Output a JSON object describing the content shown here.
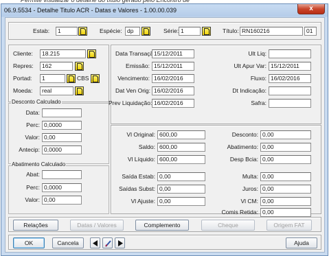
{
  "page_caption": "Permite visualizar o detalhe do título gerado pelo Encontro de",
  "window": {
    "title": "06.9.5534 - Detalhe Titulo ACR - Datas e Valores - 1.00.00.039",
    "close_symbol": "x"
  },
  "header": {
    "estab_label": "Estab:",
    "estab_value": "1",
    "especie_label": "Espécie:",
    "especie_value": "dp",
    "serie_label": "Série:",
    "serie_value": "1",
    "titulo_label": "Título:",
    "titulo_value": "RN160216",
    "parcela_value": "01"
  },
  "client": {
    "cliente_label": "Cliente:",
    "cliente_value": "18.215",
    "repres_label": "Repres:",
    "repres_value": "162",
    "portad_label": "Portad:",
    "portad_value": "1",
    "carteira_value": "CBS",
    "moeda_label": "Moeda:",
    "moeda_value": "real"
  },
  "dates": {
    "data_transacao_label": "Data Transação:",
    "data_transacao": "15/12/2011",
    "emissao_label": "Emissão:",
    "emissao": "15/12/2011",
    "vencimento_label": "Vencimento:",
    "vencimento": "16/02/2016",
    "dat_ven_orig_label": "Dat Ven Orig:",
    "dat_ven_orig": "16/02/2016",
    "prev_liquidacao_label": "Prev Liquidação:",
    "prev_liquidacao": "16/02/2016",
    "ult_liq_label": "Ult Liq:",
    "ult_liq": "",
    "ult_apur_var_label": "Ult Apur Var:",
    "ult_apur_var": "15/12/2011",
    "fluxo_label": "Fluxo:",
    "fluxo": "16/02/2016",
    "dt_indicacao_label": "Dt Indicação:",
    "dt_indicacao": "",
    "safra_label": "Safra:",
    "safra": ""
  },
  "desconto": {
    "title": "Desconto Calculado",
    "data_label": "Data:",
    "data_value": "",
    "perc_label": "Perc:",
    "perc_value": "0,0000",
    "valor_label": "Valor:",
    "valor_value": "0,00",
    "antecip_label": "Antecip:",
    "antecip_value": "0,0000"
  },
  "abatimento": {
    "title": "Abatimento Calculado",
    "abat_label": "Abat:",
    "abat_value": "",
    "perc_label": "Perc:",
    "perc_value": "0,0000",
    "valor_label": "Valor:",
    "valor_value": "0,00"
  },
  "values": {
    "vl_original_label": "Vl Original:",
    "vl_original": "600,00",
    "saldo_label": "Saldo:",
    "saldo": "600,00",
    "vl_liquido_label": "Vl Líquido:",
    "vl_liquido": "600,00",
    "saida_estab_label": "Saída Estab:",
    "saida_estab": "0,00",
    "saidas_subst_label": "Saídas Subst:",
    "saidas_subst": "0,00",
    "vl_ajuste_label": "Vl Ajuste:",
    "vl_ajuste": "0,00",
    "desconto_label": "Desconto:",
    "desconto": "0,00",
    "abatimento_label": "Abatimento:",
    "abatimento": "0,00",
    "desp_bcia_label": "Desp Bcia:",
    "desp_bcia": "0,00",
    "multa_label": "Multa:",
    "multa": "0,00",
    "juros_label": "Juros:",
    "juros": "0,00",
    "vl_cm_label": "Vl CM:",
    "vl_cm": "0,00",
    "comis_retida_label": "Comis Retida:",
    "comis_retida": "0,00"
  },
  "tabs": {
    "relacoes": "Relações",
    "datas_valores": "Datas / Valores",
    "complemento": "Complemento",
    "cheque": "Cheque",
    "origem_fat": "Origem FAT"
  },
  "footer": {
    "ok": "OK",
    "cancela": "Cancela",
    "ajuda": "Ajuda"
  }
}
